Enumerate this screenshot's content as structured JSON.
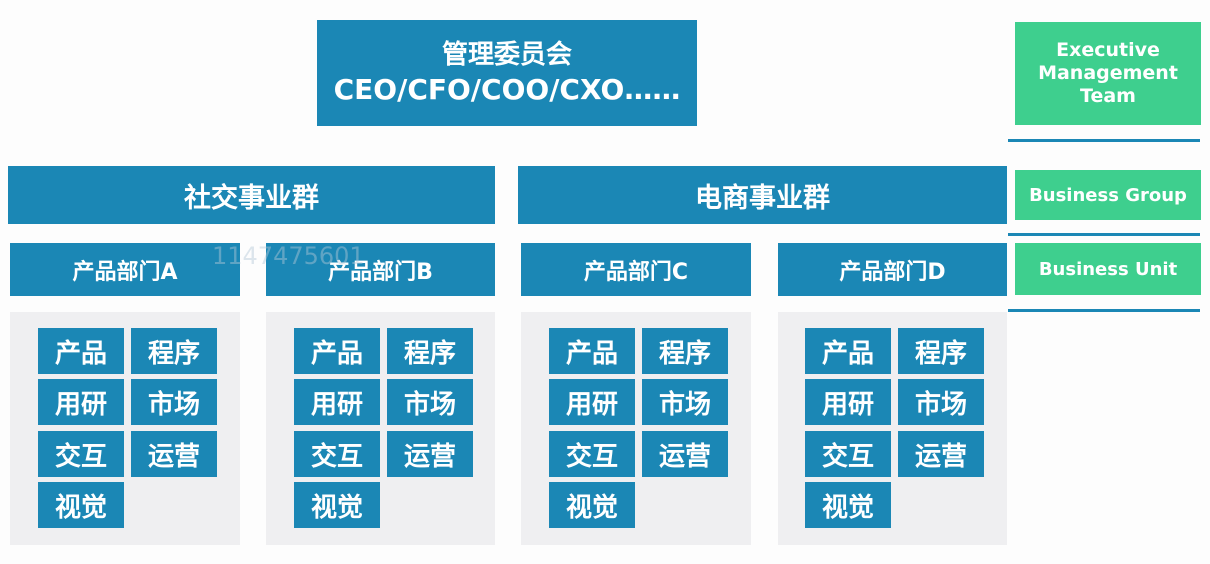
{
  "executive": {
    "line1": "管理委员会",
    "line2": "CEO/CFO/COO/CXO……"
  },
  "legend": {
    "executive_team": "Executive Management Team",
    "business_group": "Business Group",
    "business_unit": "Business Unit"
  },
  "groups": [
    {
      "label": "社交事业群"
    },
    {
      "label": "电商事业群"
    }
  ],
  "departments": [
    {
      "label": "产品部门A"
    },
    {
      "label": "产品部门B"
    },
    {
      "label": "产品部门C"
    },
    {
      "label": "产品部门D"
    }
  ],
  "functions": [
    "产品",
    "程序",
    "用研",
    "市场",
    "交互",
    "运营",
    "视觉"
  ],
  "watermark": "1147475601",
  "colors": {
    "primary_blue": "#1b87b5",
    "legend_green": "#3ecf8e",
    "panel_gray": "#efeff1"
  }
}
